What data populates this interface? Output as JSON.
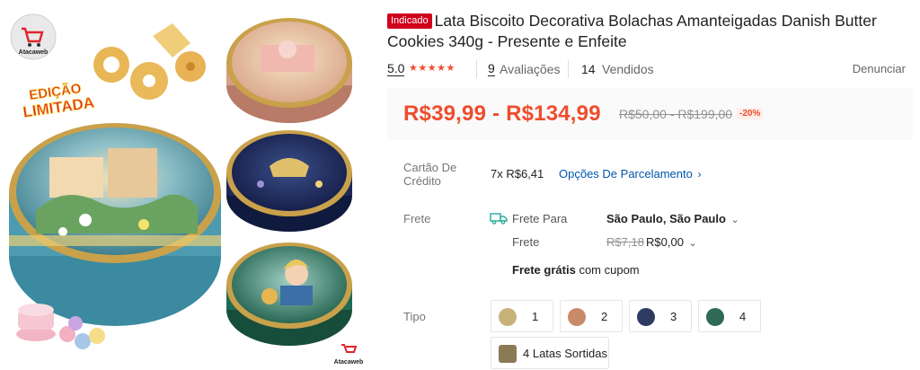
{
  "image": {
    "logo_text": "Atacaweb",
    "edition_text_1": "EDIÇÃO",
    "edition_text_2": "LIMITADA",
    "watermark_text": "Atacaweb",
    "tin_colors": {
      "tin1": "#e9c6a6",
      "tin2": "#1d2c61",
      "tin3": "#1f6b54",
      "big_tin_top": "#6fa6b3",
      "rim_gold": "#c9a14b"
    }
  },
  "product": {
    "badge": "Indicado",
    "title": "Lata Biscoito Decorativa Bolachas Amanteigadas Danish Butter Cookies 340g - Presente e Enfeite"
  },
  "stats": {
    "rating": "5.0",
    "stars": "★★★★★",
    "reviews_count": "9",
    "reviews_label": "Avaliações",
    "sold_count": "14",
    "sold_label": "Vendidos",
    "report_label": "Denunciar"
  },
  "price": {
    "range": "R$39,99 - R$134,99",
    "original_range": "R$50,00 - R$199,00",
    "discount": "-20%"
  },
  "payment": {
    "label_line1": "Cartão De",
    "label_line2": "Crédito",
    "installment": "7x R$6,41",
    "options_link": "Opções De Parcelamento"
  },
  "shipping": {
    "label": "Frete",
    "to_label": "Frete Para",
    "destination": "São Paulo, São Paulo",
    "cost_label": "Frete",
    "old_cost": "R$7,18",
    "new_cost": "R$0,00",
    "free_bold": "Frete grátis",
    "free_rest": "com cupom"
  },
  "variants": {
    "label": "Tipo",
    "options": [
      {
        "label": "1",
        "color": "#c9b27a"
      },
      {
        "label": "2",
        "color": "#c98a6a"
      },
      {
        "label": "3",
        "color": "#2d3b63"
      },
      {
        "label": "4",
        "color": "#2f6a55"
      },
      {
        "label": "4 Latas Sortidas",
        "color": "#8a7a55"
      }
    ]
  }
}
